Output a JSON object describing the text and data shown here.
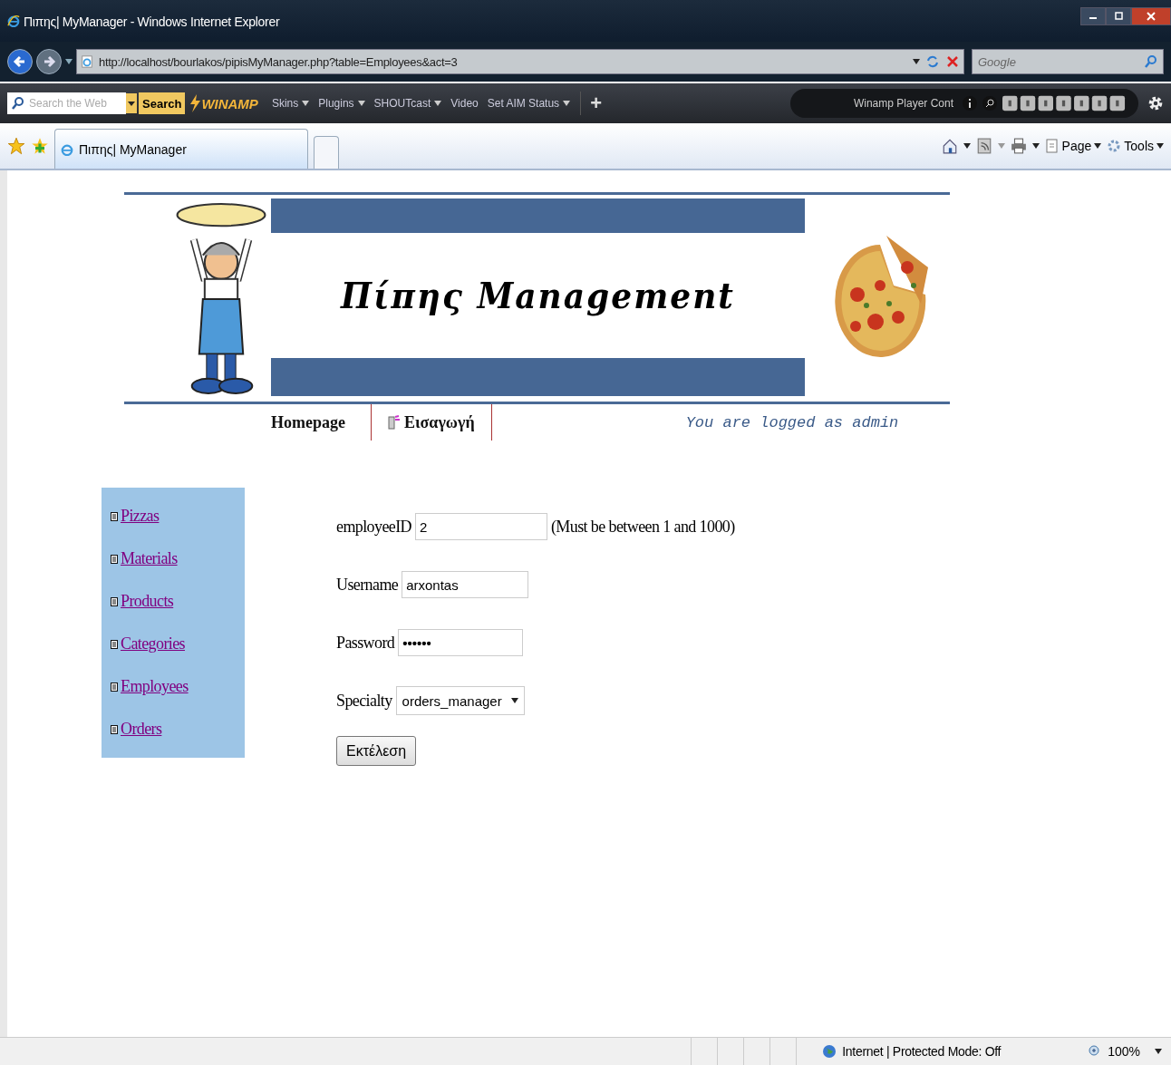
{
  "window": {
    "title": "Πιπης| MyManager - Windows Internet Explorer"
  },
  "address_bar": {
    "url": "http://localhost/bourlakos/pipisMyManager.php?table=Employees&act=3"
  },
  "search_box": {
    "placeholder": "Google"
  },
  "toolbar": {
    "search_placeholder": "Search the Web",
    "search_button": "Search",
    "logo": "WINAMP",
    "menus": [
      {
        "label": "Skins",
        "dropdown": true
      },
      {
        "label": "Plugins",
        "dropdown": true
      },
      {
        "label": "SHOUTcast",
        "dropdown": true
      },
      {
        "label": "Video",
        "dropdown": false
      },
      {
        "label": "Set AIM Status",
        "dropdown": true
      }
    ],
    "add_button": "+",
    "player_label": "Winamp Player Cont"
  },
  "tabs": [
    {
      "label": "Πιπης| MyManager",
      "selected": true
    }
  ],
  "command_bar": [
    {
      "label": "Page"
    },
    {
      "label": "Tools"
    }
  ],
  "page": {
    "title": "Πίπης Management",
    "nav": [
      {
        "label": "Homepage",
        "kind": "text"
      },
      {
        "label": "Εισαγωγή",
        "kind": "icon"
      }
    ],
    "login_text": "You are logged as admin",
    "sidebar": [
      {
        "label": "Pizzas"
      },
      {
        "label": "Materials"
      },
      {
        "label": "Products"
      },
      {
        "label": "Categories"
      },
      {
        "label": "Employees"
      },
      {
        "label": "Orders"
      }
    ],
    "form": [
      {
        "label": "employeeID",
        "kind": "text",
        "value": "2",
        "hint": "(Must be between 1 and 1000)"
      },
      {
        "label": "Username",
        "kind": "text",
        "value": "arxontas"
      },
      {
        "label": "Password",
        "kind": "password",
        "value": "••••••"
      },
      {
        "label": "Specialty",
        "kind": "select",
        "value": "orders_manager"
      }
    ],
    "submit": "Εκτέλεση"
  },
  "status_bar": {
    "zone": "Internet | Protected Mode: Off",
    "zoom": "100%"
  }
}
